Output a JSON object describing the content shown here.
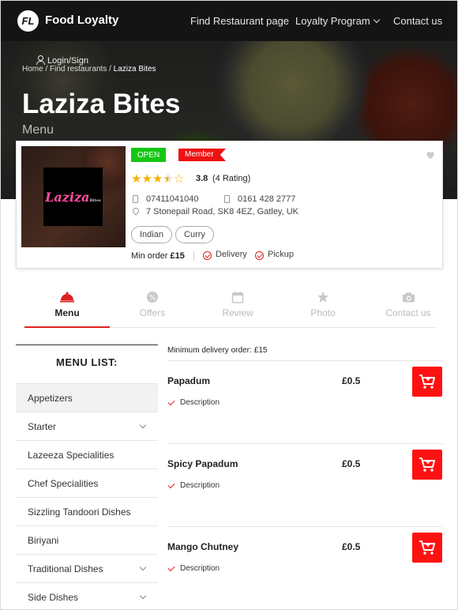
{
  "nav": {
    "logo_initials": "FL",
    "brand": "Food Loyalty",
    "links": [
      "Find Restaurant page",
      "Loyalty Program",
      "Contact us"
    ]
  },
  "hero": {
    "login": "Login/Sign",
    "breadcrumb": [
      "Home",
      "Find restaurants",
      "Laziza Bites"
    ],
    "title": "Laziza Bites",
    "subtitle": "Menu"
  },
  "card": {
    "logo_text": "Laziza",
    "logo_suffix": "Bites",
    "status": "OPEN",
    "member": "Member",
    "rating_value": "3.8",
    "rating_count": "(4 Rating)",
    "phone1": "07411041040",
    "phone2": "0161 428 2777",
    "address": "7 Stonepail Road, SK8 4EZ, Gatley, UK",
    "tags": [
      "Indian",
      "Curry"
    ],
    "min_order_label": "Min order",
    "min_order_value": "£15",
    "delivery": "Delivery",
    "pickup": "Pickup",
    "colors": {
      "open": "#15c615",
      "member": "#ee1111",
      "star": "#f5b301",
      "accent": "#e02020"
    }
  },
  "tabs": [
    "Menu",
    "Offers",
    "Review",
    "Photo",
    "Contact us"
  ],
  "sidebar": {
    "title": "MENU LIST:",
    "items": [
      "Appetizers",
      "Starter",
      "Lazeeza Specialities",
      "Chef Specialities",
      "Sizzling Tandoori Dishes",
      "Biriyani",
      "Traditional Dishes",
      "Side Dishes"
    ]
  },
  "menu": {
    "min_delivery_label": "Minimum delivery order:",
    "min_delivery_value": "£15",
    "dishes": [
      {
        "name": "Papadum",
        "price": "£0.5",
        "desc": "Description"
      },
      {
        "name": "Spicy Papadum",
        "price": "£0.5",
        "desc": "Description"
      },
      {
        "name": "Mango Chutney",
        "price": "£0.5",
        "desc": "Description"
      }
    ]
  }
}
